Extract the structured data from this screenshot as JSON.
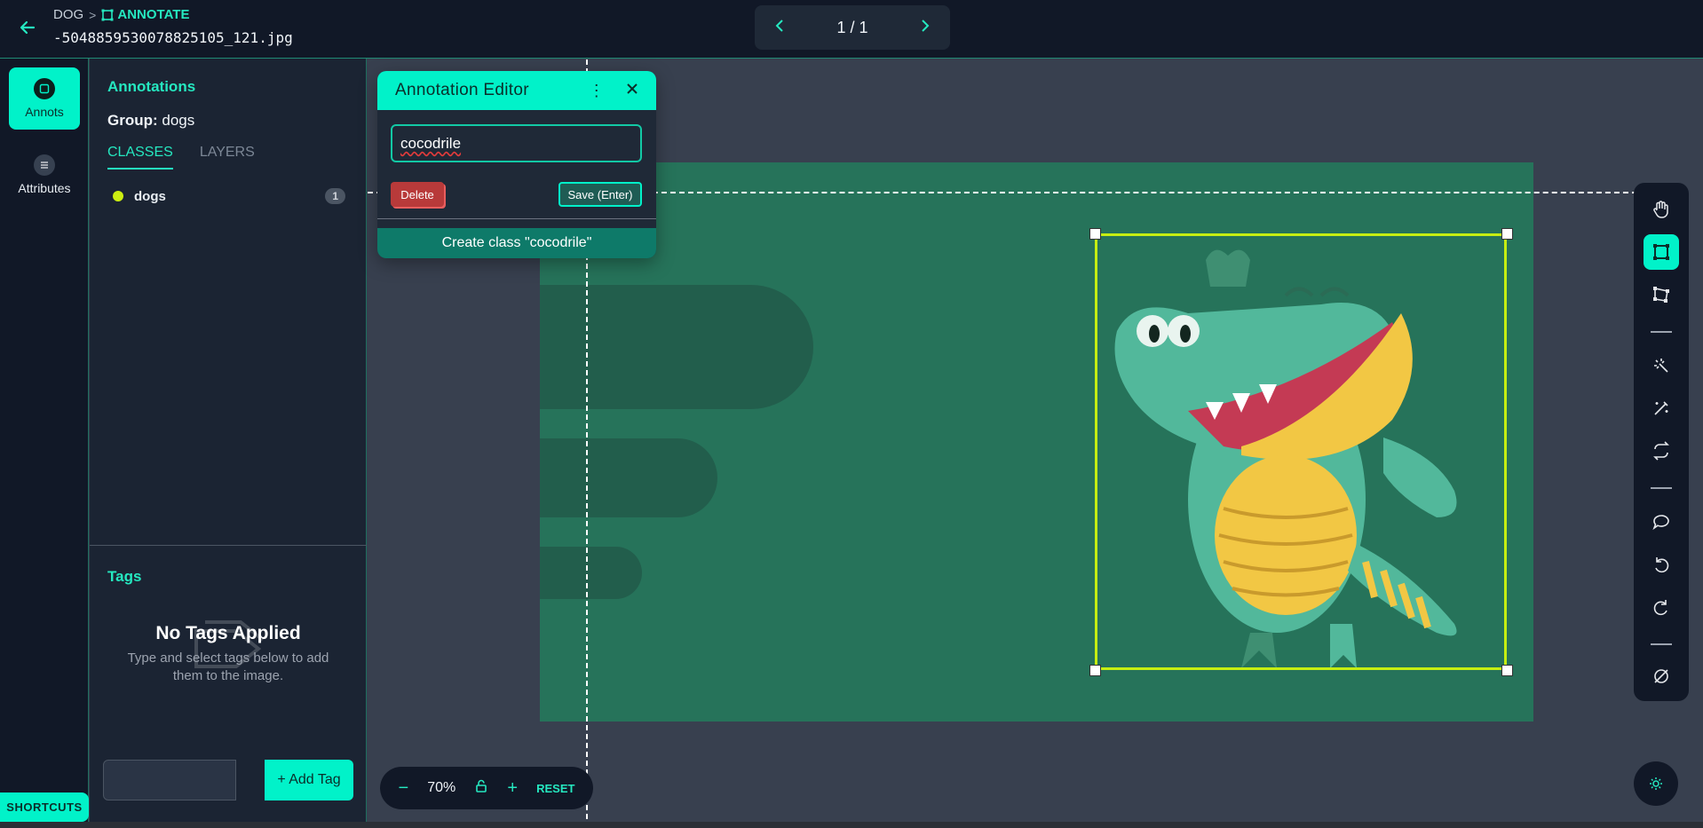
{
  "header": {
    "breadcrumb_project": "DOG",
    "breadcrumb_separator": ">",
    "breadcrumb_mode": "ANNOTATE",
    "filename": "-5048859530078825105_121.jpg",
    "pager_count": "1 / 1"
  },
  "rail": {
    "annots_label": "Annots",
    "attributes_label": "Attributes",
    "shortcuts_label": "SHORTCUTS"
  },
  "panel": {
    "title": "Annotations",
    "group_label": "Group:",
    "group_value": "dogs",
    "tab_classes": "CLASSES",
    "tab_layers": "LAYERS",
    "classes": [
      {
        "name": "dogs",
        "count": "1",
        "color": "#ccee11"
      }
    ],
    "tags_title": "Tags",
    "no_tags_title": "No Tags Applied",
    "no_tags_sub": "Type and select tags below to add them to the image.",
    "add_tag_label": "+ Add Tag"
  },
  "editor": {
    "title": "Annotation Editor",
    "input_value": "cocodrile",
    "delete_label": "Delete",
    "save_label": "Save (Enter)",
    "create_label": "Create class \"cocodrile\""
  },
  "zoom": {
    "minus": "−",
    "value": "70%",
    "plus": "+",
    "reset": "RESET"
  },
  "colors": {
    "accent": "#01f2c9",
    "bbox": "#c6ee12",
    "delete": "#b83a3a"
  },
  "toolbar_icons": [
    "pan-hand-icon",
    "bbox-tool-icon",
    "polygon-tool-icon",
    "magic-select-icon",
    "magic-wand-icon",
    "swap-icon",
    "comment-icon",
    "undo-icon",
    "redo-icon",
    "hide-icon"
  ]
}
